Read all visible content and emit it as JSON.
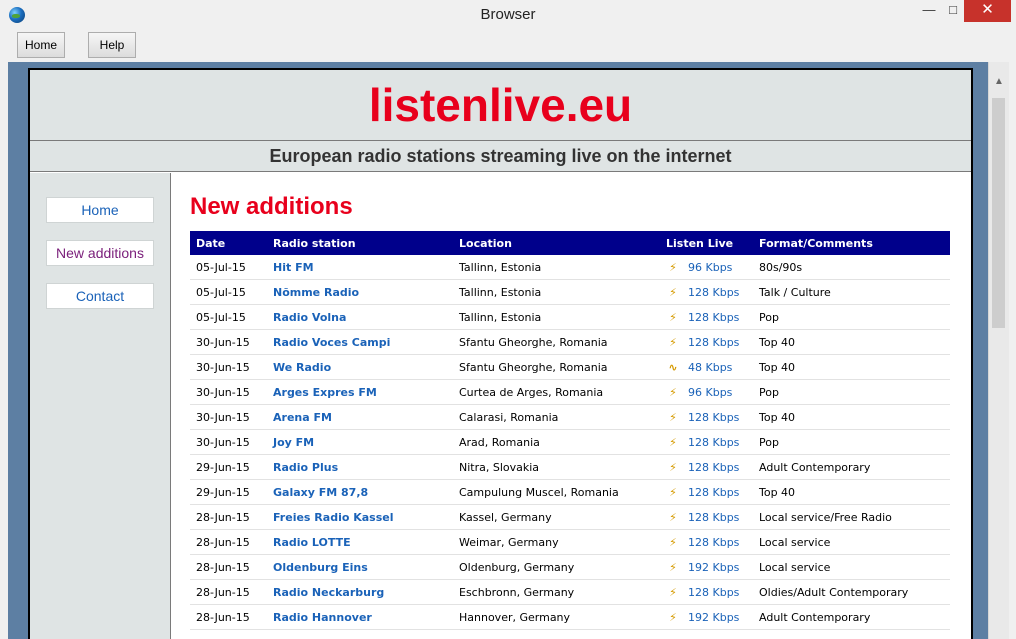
{
  "window": {
    "title": "Browser",
    "min": "—",
    "max": "□",
    "close": "✕"
  },
  "toolbar": {
    "home_label": "Home",
    "help_label": "Help"
  },
  "site": {
    "logo": "listenlive.eu",
    "tagline": "European radio stations streaming live on the internet"
  },
  "nav": [
    {
      "label": "Home"
    },
    {
      "label": "New additions"
    },
    {
      "label": "Contact"
    }
  ],
  "main": {
    "heading": "New additions",
    "columns": [
      "Date",
      "Radio station",
      "Location",
      "Listen Live",
      "Format/Comments"
    ],
    "rows": [
      {
        "date": "05-Jul-15",
        "station": "Hit FM",
        "location": "Tallinn, Estonia",
        "icon": "plug-icon",
        "kbps": "96 Kbps",
        "format": "80s/90s"
      },
      {
        "date": "05-Jul-15",
        "station": "Nõmme Radio",
        "location": "Tallinn, Estonia",
        "icon": "plug-icon",
        "kbps": "128 Kbps",
        "format": "Talk / Culture"
      },
      {
        "date": "05-Jul-15",
        "station": "Radio Volna",
        "location": "Tallinn, Estonia",
        "icon": "plug-icon",
        "kbps": "128 Kbps",
        "format": "Pop"
      },
      {
        "date": "30-Jun-15",
        "station": "Radio Voces Campi",
        "location": "Sfantu Gheorghe, Romania",
        "icon": "plug-icon",
        "kbps": "128 Kbps",
        "format": "Top 40"
      },
      {
        "date": "30-Jun-15",
        "station": "We Radio",
        "location": "Sfantu Gheorghe, Romania",
        "icon": "wave-icon",
        "kbps": "48 Kbps",
        "format": "Top 40"
      },
      {
        "date": "30-Jun-15",
        "station": "Arges Expres FM",
        "location": "Curtea de Arges, Romania",
        "icon": "plug-icon",
        "kbps": "96 Kbps",
        "format": "Pop"
      },
      {
        "date": "30-Jun-15",
        "station": "Arena FM",
        "location": "Calarasi, Romania",
        "icon": "plug-icon",
        "kbps": "128 Kbps",
        "format": "Top 40"
      },
      {
        "date": "30-Jun-15",
        "station": "Joy FM",
        "location": "Arad, Romania",
        "icon": "plug-icon",
        "kbps": "128 Kbps",
        "format": "Pop"
      },
      {
        "date": "29-Jun-15",
        "station": "Radio Plus",
        "location": "Nitra, Slovakia",
        "icon": "plug-icon",
        "kbps": "128 Kbps",
        "format": "Adult Contemporary"
      },
      {
        "date": "29-Jun-15",
        "station": "Galaxy FM 87,8",
        "location": "Campulung Muscel, Romania",
        "icon": "plug-icon",
        "kbps": "128 Kbps",
        "format": "Top 40"
      },
      {
        "date": "28-Jun-15",
        "station": "Freies Radio Kassel",
        "location": "Kassel, Germany",
        "icon": "plug-icon",
        "kbps": "128 Kbps",
        "format": "Local service/Free Radio"
      },
      {
        "date": "28-Jun-15",
        "station": "Radio LOTTE",
        "location": "Weimar, Germany",
        "icon": "plug-icon",
        "kbps": "128 Kbps",
        "format": "Local service"
      },
      {
        "date": "28-Jun-15",
        "station": "Oldenburg Eins",
        "location": "Oldenburg, Germany",
        "icon": "plug-icon",
        "kbps": "192 Kbps",
        "format": "Local service"
      },
      {
        "date": "28-Jun-15",
        "station": "Radio Neckarburg",
        "location": "Eschbronn, Germany",
        "icon": "plug-icon",
        "kbps": "128 Kbps",
        "format": "Oldies/Adult Contemporary"
      },
      {
        "date": "28-Jun-15",
        "station": "Radio Hannover",
        "location": "Hannover, Germany",
        "icon": "plug-icon",
        "kbps": "192 Kbps",
        "format": "Adult Contemporary"
      }
    ]
  },
  "colors": {
    "accent_red": "#e8001c",
    "header_bg": "#00008b",
    "link_blue": "#1a62b8"
  }
}
